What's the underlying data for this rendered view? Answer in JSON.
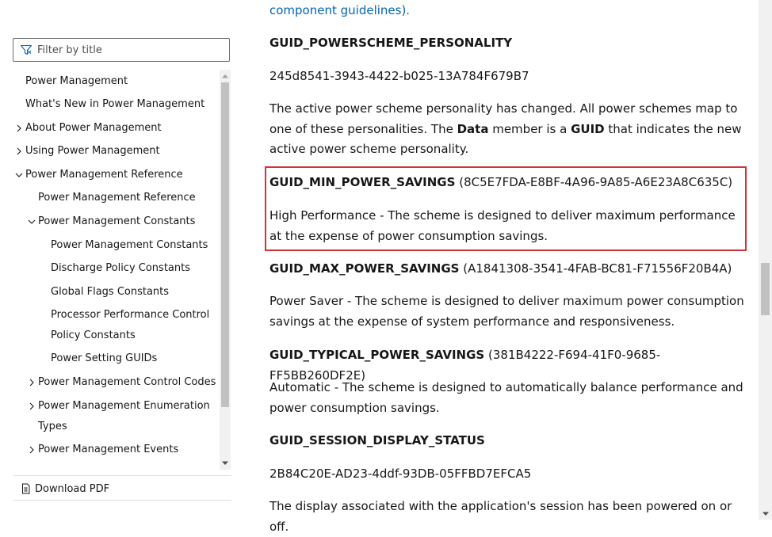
{
  "sidebar": {
    "filter": {
      "placeholder": "Filter by title",
      "value": ""
    },
    "toc": [
      {
        "label": "Power Management",
        "level": 0,
        "chevron": "none"
      },
      {
        "label": "What's New in Power Management",
        "level": 0,
        "chevron": "none"
      },
      {
        "label": "About Power Management",
        "level": 0,
        "chevron": "right"
      },
      {
        "label": "Using Power Management",
        "level": 0,
        "chevron": "right"
      },
      {
        "label": "Power Management Reference",
        "level": 0,
        "chevron": "down"
      },
      {
        "label": "Power Management Reference",
        "level": 1,
        "chevron": "none"
      },
      {
        "label": "Power Management Constants",
        "level": 1,
        "chevron": "down"
      },
      {
        "label": "Power Management Constants",
        "level": 2,
        "chevron": "none"
      },
      {
        "label": "Discharge Policy Constants",
        "level": 2,
        "chevron": "none"
      },
      {
        "label": "Global Flags Constants",
        "level": 2,
        "chevron": "none"
      },
      {
        "label": "Processor Performance Control Policy Constants",
        "level": 2,
        "chevron": "none"
      },
      {
        "label": "Power Setting GUIDs",
        "level": 2,
        "chevron": "none",
        "selected": true
      },
      {
        "label": "Power Management Control Codes",
        "level": 1,
        "chevron": "right"
      },
      {
        "label": "Power Management Enumeration Types",
        "level": 1,
        "chevron": "right"
      },
      {
        "label": "Power Management Events",
        "level": 1,
        "chevron": "right"
      }
    ],
    "download_label": "Download PDF"
  },
  "main": {
    "top_link": "component guidelines).",
    "personality": {
      "name": "GUID_POWERSCHEME_PERSONALITY",
      "guid": "245d8541-3943-4422-b025-13A784F679B7",
      "desc_1": "The active power scheme personality has changed. All power schemes map to one of these personalities. The ",
      "desc_bold_1": "Data",
      "desc_2": " member is a ",
      "desc_bold_2": "GUID",
      "desc_3": " that indicates the new active power scheme personality."
    },
    "min_savings": {
      "name": "GUID_MIN_POWER_SAVINGS",
      "guid": "(8C5E7FDA-E8BF-4A96-9A85-A6E23A8C635C)",
      "desc": "High Performance - The scheme is designed to deliver maximum performance at the expense of power consumption savings."
    },
    "max_savings": {
      "name": "GUID_MAX_POWER_SAVINGS",
      "guid": "(A1841308-3541-4FAB-BC81-F71556F20B4A)",
      "desc": "Power Saver - The scheme is designed to deliver maximum power consumption savings at the expense of system performance and responsiveness."
    },
    "typical_savings": {
      "name": "GUID_TYPICAL_POWER_SAVINGS",
      "guid": "(381B4222-F694-41F0-9685-FF5BB260DF2E)",
      "desc": "Automatic - The scheme is designed to automatically balance performance and power consumption savings."
    },
    "display_status": {
      "name": "GUID_SESSION_DISPLAY_STATUS",
      "guid": "2B84C20E-AD23-4ddf-93DB-05FFBD7EFCA5",
      "desc": "The display associated with the application's session has been powered on or off."
    }
  },
  "colors": {
    "link": "#0065b3",
    "highlight_border": "#d13438",
    "selected_bg": "#f2f2f2"
  },
  "icons": {
    "filter": "filter-icon",
    "download": "pdf-download-icon"
  }
}
